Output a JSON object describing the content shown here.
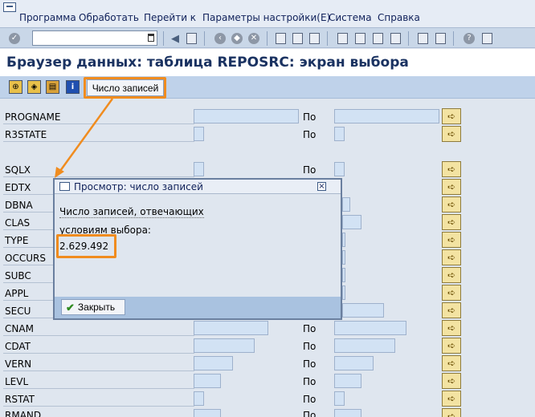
{
  "menu": [
    "Программа",
    "Обработать",
    "Перейти к",
    "Параметры настройки(E)",
    "Система",
    "Справка"
  ],
  "page_title": "Браузер данных: таблица REPOSRC: экран выбора",
  "toolbar_button": "Число записей",
  "range_label": "По",
  "fields": [
    "PROGNAME",
    "R3STATE",
    "SQLX",
    "EDTX",
    "DBNA",
    "CLAS",
    "TYPE",
    "OCCURS",
    "SUBC",
    "APPL",
    "SECU",
    "CNAM",
    "CDAT",
    "VERN",
    "LEVL",
    "RSTAT",
    "RMAND"
  ],
  "dialog": {
    "title": "Просмотр: число записей",
    "line1": "Число записей, отвечающих",
    "line2": "условиям выбора:",
    "value": "2.629.492",
    "close_button": "Закрыть"
  },
  "colors": {
    "highlight": "#f08c1f",
    "title": "#1a3261"
  }
}
